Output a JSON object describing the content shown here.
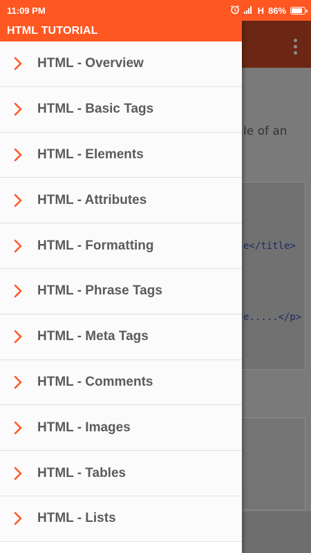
{
  "status_bar": {
    "time": "11:09 PM",
    "network": "H",
    "battery_text": "86%",
    "battery_level": 0.86
  },
  "drawer": {
    "title": "HTML TUTORIAL",
    "items": [
      {
        "label": "HTML - Overview"
      },
      {
        "label": "HTML - Basic Tags"
      },
      {
        "label": "HTML - Elements"
      },
      {
        "label": "HTML - Attributes"
      },
      {
        "label": "HTML - Formatting"
      },
      {
        "label": "HTML - Phrase Tags"
      },
      {
        "label": "HTML - Meta Tags"
      },
      {
        "label": "HTML - Comments"
      },
      {
        "label": "HTML - Images"
      },
      {
        "label": "HTML - Tables"
      },
      {
        "label": "HTML - Lists"
      }
    ]
  },
  "background": {
    "text_fragment": "le of an",
    "code_line_1": "e</title>",
    "code_line_2": "e.....</p>"
  },
  "colors": {
    "accent": "#ff5722",
    "chevron": "#ff5722",
    "label": "#5b5b5b",
    "scrim_appbar": "#6b2614"
  },
  "icons": {
    "alarm": "alarm-icon",
    "signal": "signal-icon",
    "battery": "battery-icon",
    "more": "more-vert-icon",
    "chevron": "chevron-right-icon"
  }
}
